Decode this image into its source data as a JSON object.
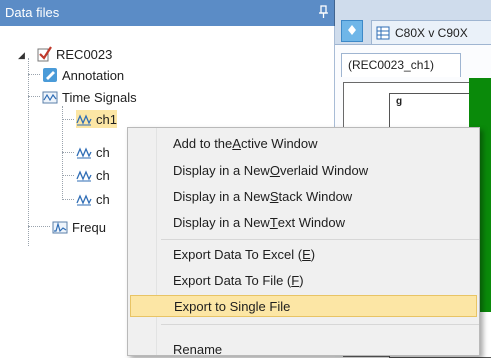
{
  "panel": {
    "title": "Data files"
  },
  "tree": {
    "root": "REC0023",
    "annotation": "Annotation",
    "time_signals": "Time Signals",
    "channels": [
      "ch1",
      "ch",
      "ch",
      "ch"
    ],
    "frequency": "Frequ"
  },
  "document": {
    "tab_label": "C80X v C90X",
    "subtab_label": "(REC0023_ch1)",
    "plot_label": "g"
  },
  "context_menu": {
    "items": [
      {
        "pre": "Add to the ",
        "key": "A",
        "post": "ctive Window"
      },
      {
        "pre": "Display in a New ",
        "key": "O",
        "post": "verlaid Window"
      },
      {
        "pre": "Display in a New ",
        "key": "S",
        "post": "tack Window"
      },
      {
        "pre": "Display in a New ",
        "key": "T",
        "post": "ext Window"
      },
      {
        "pre": "Export Data To Excel (",
        "key": "E",
        "post": ")"
      },
      {
        "pre": "Export Data To File (",
        "key": "F",
        "post": ")"
      },
      {
        "pre": "Export to Single File",
        "key": "",
        "post": ""
      },
      {
        "pre": "Rename",
        "key": "",
        "post": ""
      }
    ],
    "highlighted_index": 6
  },
  "colors": {
    "header": "#5b8cc6",
    "highlight": "#fce6a5",
    "plot_green": "#0a8a0a"
  }
}
